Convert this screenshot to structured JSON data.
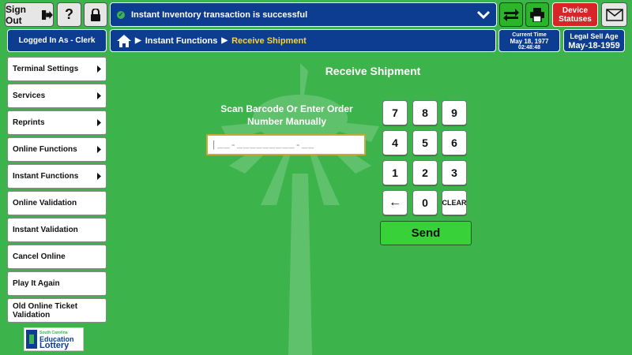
{
  "topbar": {
    "sign_out_label": "Sign Out",
    "help_label": "?",
    "notification": "Instant Inventory transaction is successful",
    "device_statuses_label": "Device Statuses"
  },
  "header": {
    "logged_in": "Logged In As - Clerk",
    "breadcrumb": [
      "Instant Functions",
      "Receive Shipment"
    ],
    "current_time_label": "Current Time",
    "current_date": "May 18, 1977",
    "current_clock": "02:48:48",
    "legal_age_label": "Legal Sell Age",
    "legal_age_date": "May-18-1959"
  },
  "sidebar": {
    "items": [
      {
        "label": "Terminal Settings",
        "arrow": true
      },
      {
        "label": "Services",
        "arrow": true
      },
      {
        "label": "Reprints",
        "arrow": true
      },
      {
        "label": "Online Functions",
        "arrow": true
      },
      {
        "label": "Instant Functions",
        "arrow": true
      },
      {
        "label": "Online Validation",
        "arrow": false
      },
      {
        "label": "Instant Validation",
        "arrow": false
      },
      {
        "label": "Cancel Online",
        "arrow": false
      },
      {
        "label": "Play It Again",
        "arrow": false
      },
      {
        "label": "Old Online Ticket Validation",
        "arrow": false
      }
    ]
  },
  "main": {
    "title": "Receive Shipment",
    "prompt": "Scan Barcode Or Enter Order Number Manually",
    "barcode_mask": "|__-_________-__",
    "keypad": [
      "7",
      "8",
      "9",
      "4",
      "5",
      "6",
      "1",
      "2",
      "3",
      "←",
      "0",
      "CLEAR"
    ],
    "send_label": "Send"
  },
  "logo": {
    "line1": "South Carolina",
    "line2": "Education",
    "line3": "Lottery"
  },
  "colors": {
    "background": "#3cb44b",
    "brand_blue": "#0d3d91",
    "alert_red": "#d7262a",
    "send_green": "#39d139"
  }
}
